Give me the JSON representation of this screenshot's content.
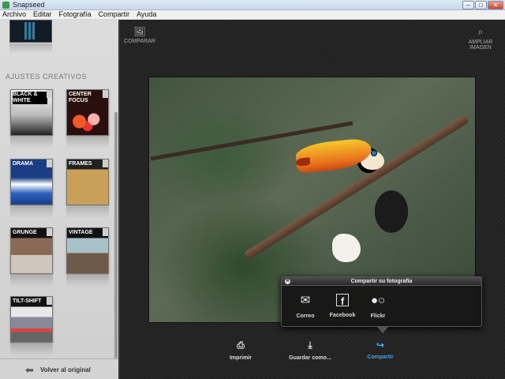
{
  "window": {
    "title": "Snapseed",
    "min_glyph": "–",
    "max_glyph": "□",
    "close_glyph": "✕"
  },
  "menu": [
    "Archivo",
    "Editar",
    "Fotografía",
    "Compartir",
    "Ayuda"
  ],
  "left_panel": {
    "section_title": "AJUSTES CREATIVOS",
    "filters": [
      {
        "label": "BLACK & WHITE"
      },
      {
        "label": "CENTER FOCUS"
      },
      {
        "label": "DRAMA"
      },
      {
        "label": "FRAMES"
      },
      {
        "label": "GRUNGE"
      },
      {
        "label": "VINTAGE"
      },
      {
        "label": "TILT-SHIFT"
      }
    ],
    "revert_label": "Volver al original"
  },
  "toolbar": {
    "compare_label": "COMPARAR",
    "zoom_label": "AMPLIAR IMAGEN"
  },
  "share_popup": {
    "title": "Compartir su fotografía",
    "options": [
      {
        "label": "Correo",
        "icon": "mail-icon"
      },
      {
        "label": "Facebook",
        "icon": "facebook-icon"
      },
      {
        "label": "Flickr",
        "icon": "flickr-icon"
      }
    ]
  },
  "actions": {
    "print_label": "Imprimir",
    "save_label": "Guardar como...",
    "share_label": "Compartir"
  },
  "colors": {
    "accent": "#3fa3e6"
  }
}
